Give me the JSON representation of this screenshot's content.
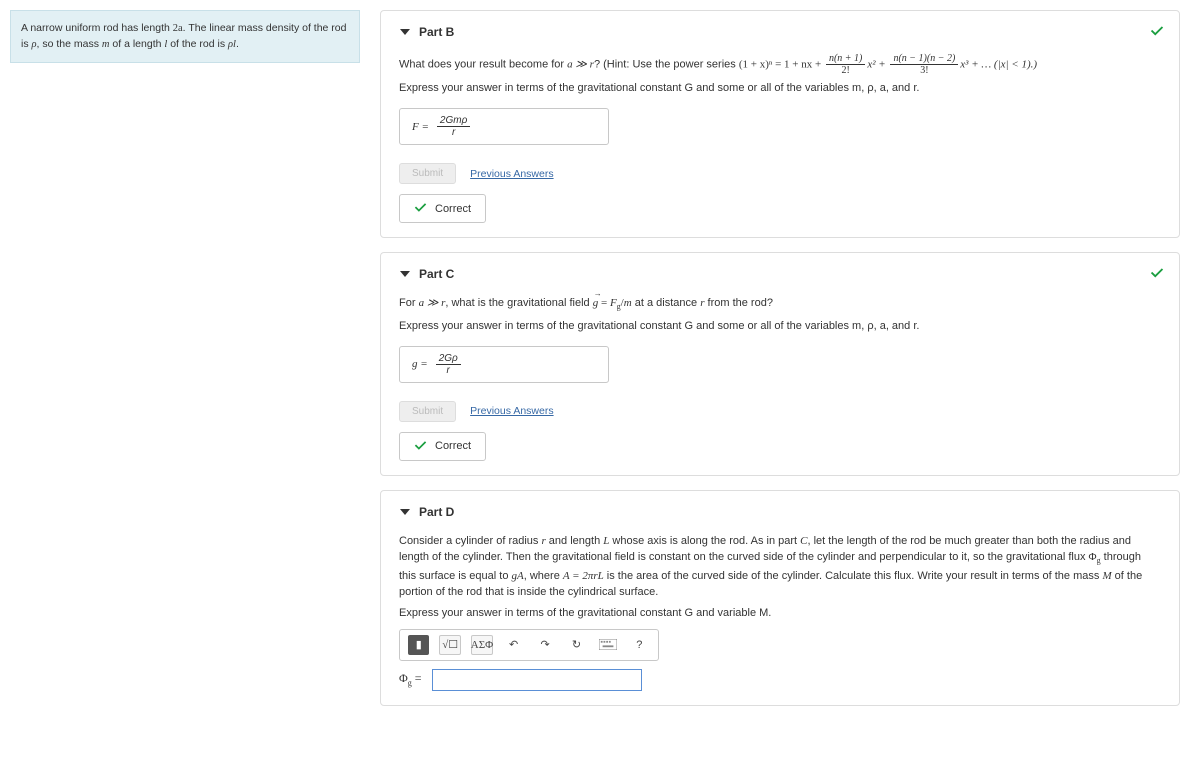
{
  "problem": {
    "text_before_2a": "A narrow uniform rod has length ",
    "length_sym": "2a",
    "text_mid1": ". The linear mass density of the rod is ",
    "rho_sym": "ρ",
    "text_mid2": ", so the mass ",
    "m_sym": "m",
    "text_mid3": " of a length ",
    "l_sym": "l",
    "text_mid4": " of the rod is ",
    "rhol_sym": "ρl",
    "text_end": "."
  },
  "partB": {
    "title": "Part B",
    "prompt_a": "What does your result become for ",
    "cond": "a ≫ r",
    "prompt_b": "? (Hint: Use the power series ",
    "series": "(1 + x)ⁿ = 1 + nx + ",
    "frac1_num": "n(n + 1)",
    "frac1_den": "2!",
    "x2": "x² + ",
    "frac2_num": "n(n − 1)(n − 2)",
    "frac2_den": "3!",
    "x3": "x³ + … (|x| < 1).)",
    "subprompt": "Express your answer in terms of the gravitational constant G and some or all of the variables m, ρ, a, and r.",
    "answer_lhs": "F =",
    "answer_num": "2Gmρ",
    "answer_den": "r",
    "submit": "Submit",
    "prev": "Previous Answers",
    "correct": "Correct"
  },
  "partC": {
    "title": "Part C",
    "prompt_a": "For ",
    "cond": "a ≫ r",
    "prompt_b": ", what is the gravitational field ",
    "g_eq": "g = F_g/m",
    "prompt_c": " at a distance ",
    "r_sym": "r",
    "prompt_d": " from the rod?",
    "subprompt": "Express your answer in terms of the gravitational constant G and some or all of the variables m, ρ, a, and r.",
    "answer_lhs": "g =",
    "answer_num": "2Gρ",
    "answer_den": "r",
    "submit": "Submit",
    "prev": "Previous Answers",
    "correct": "Correct"
  },
  "partD": {
    "title": "Part D",
    "para_a": "Consider a cylinder of radius ",
    "r_sym": "r",
    "para_b": " and length ",
    "L_sym": "L",
    "para_c": " whose axis is along the rod. As in part ",
    "C_sym": "C",
    "para_d": ", let the length of the rod be much greater than both the radius and length of the cylinder. Then the gravitational field is constant on the curved side of the cylinder and perpendicular to it, so the gravitational flux ",
    "phi_sym": "Φ_g",
    "para_e": " through this surface is equal to ",
    "gA_sym": "gA",
    "para_f": ", where ",
    "A_eq": "A = 2πrL",
    "para_g": " is the area of the curved side of the cylinder. Calculate this flux. Write your result in terms of the mass ",
    "M_sym": "M",
    "para_h": " of the portion of the rod that is inside the cylindrical surface.",
    "subprompt": "Express your answer in terms of the gravitational constant G and variable M.",
    "palette_special": "ΑΣΦ",
    "input_label": "Φ_g =",
    "input_value": ""
  }
}
